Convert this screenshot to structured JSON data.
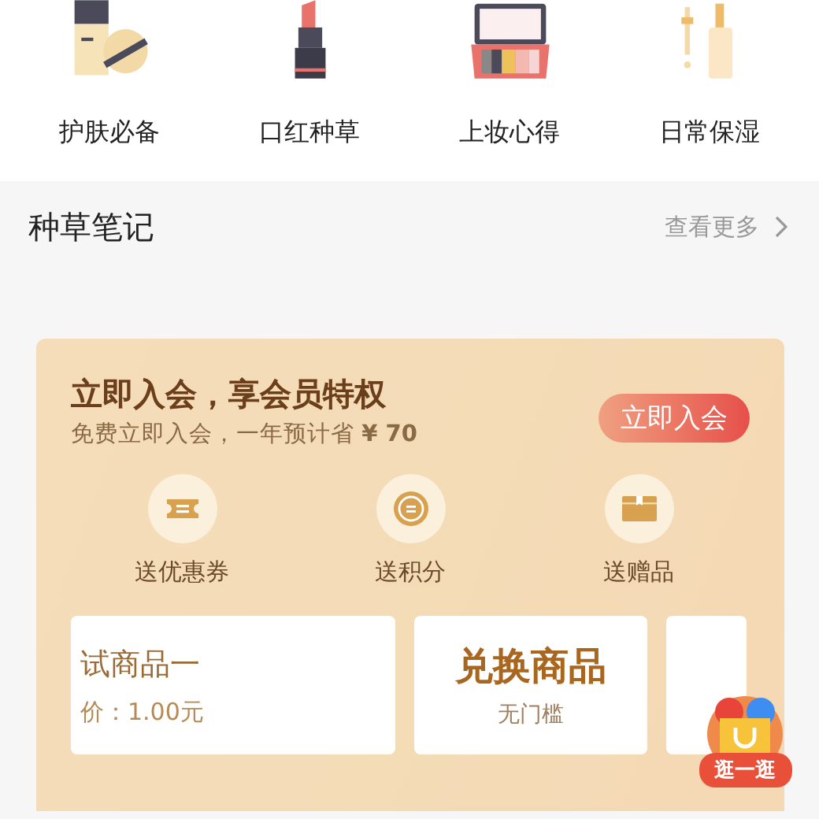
{
  "categories": [
    {
      "label": "护肤必备"
    },
    {
      "label": "口红种草"
    },
    {
      "label": "上妆心得"
    },
    {
      "label": "日常保湿"
    }
  ],
  "section": {
    "title": "种草笔记",
    "more": "查看更多"
  },
  "membership": {
    "title": "立即入会，享会员特权",
    "subtitle": "免费立即入会，一年预计省 **¥ 70**",
    "button": "立即入会"
  },
  "benefits": [
    {
      "label": "送优惠券"
    },
    {
      "label": "送积分"
    },
    {
      "label": "送赠品"
    }
  ],
  "coupons": [
    {
      "kind": "product",
      "title": "试商品一",
      "price": "价：1.00元"
    },
    {
      "kind": "exchange",
      "title": "兑换商品",
      "subtitle": "无门槛"
    },
    {
      "kind": "blank"
    }
  ],
  "floating": {
    "label": "逛一逛"
  }
}
